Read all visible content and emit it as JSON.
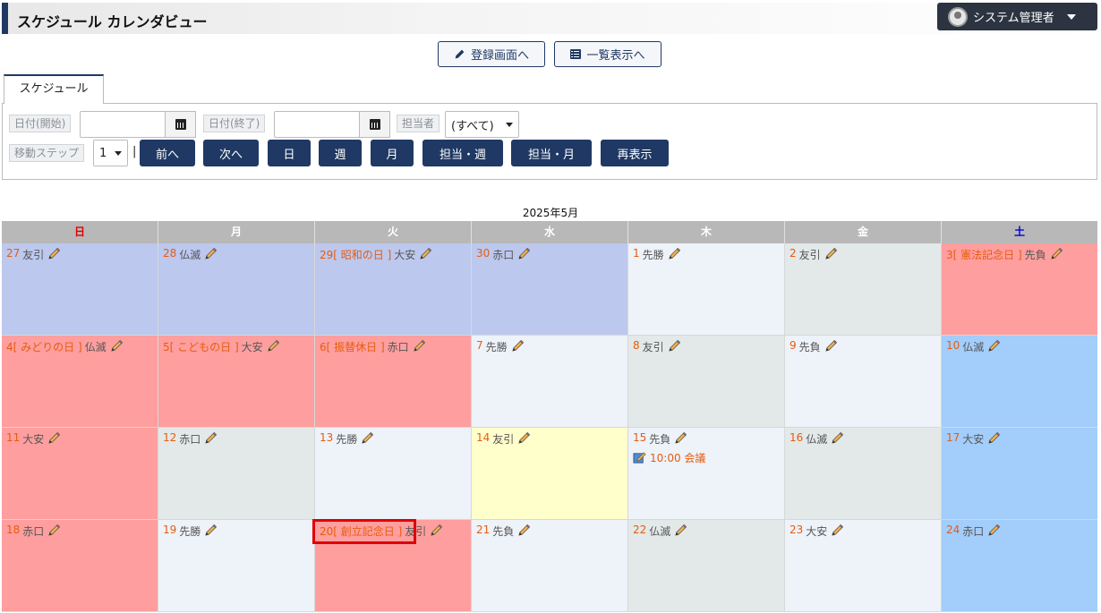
{
  "header": {
    "title": "スケジュール カレンダビュー",
    "user": "システム管理者"
  },
  "top_buttons": {
    "register": "登録画面へ",
    "list": "一覧表示へ"
  },
  "tab": {
    "label": "スケジュール"
  },
  "filters": {
    "date_start_label": "日付(開始)",
    "date_end_label": "日付(終了)",
    "assignee_label": "担当者",
    "assignee_value": "(すべて)",
    "step_label": "移動ステップ",
    "step_value": "1",
    "separator": "|"
  },
  "nav_buttons": [
    "前へ",
    "次へ",
    "日",
    "週",
    "月",
    "担当・週",
    "担当・月",
    "再表示"
  ],
  "calendar": {
    "month": "2025年5月",
    "weekdays": [
      "日",
      "月",
      "火",
      "水",
      "木",
      "金",
      "土"
    ],
    "weeks": [
      [
        {
          "label": "27",
          "rokuyo": "友引",
          "type": "prev"
        },
        {
          "label": "28",
          "rokuyo": "仏滅",
          "type": "prev"
        },
        {
          "label": "29[ 昭和の日 ]",
          "rokuyo": "大安",
          "type": "prev"
        },
        {
          "label": "30",
          "rokuyo": "赤口",
          "type": "prev"
        },
        {
          "label": "1",
          "rokuyo": "先勝",
          "type": "weekday"
        },
        {
          "label": "2",
          "rokuyo": "友引",
          "type": "thu"
        },
        {
          "label": "3[ 憲法記念日 ]",
          "rokuyo": "先負",
          "type": "holiday"
        }
      ],
      [
        {
          "label": "4[ みどりの日 ]",
          "rokuyo": "仏滅",
          "type": "holiday"
        },
        {
          "label": "5[ こどもの日 ]",
          "rokuyo": "大安",
          "type": "holiday"
        },
        {
          "label": "6[ 振替休日 ]",
          "rokuyo": "赤口",
          "type": "holiday"
        },
        {
          "label": "7",
          "rokuyo": "先勝",
          "type": "weekday"
        },
        {
          "label": "8",
          "rokuyo": "友引",
          "type": "thu"
        },
        {
          "label": "9",
          "rokuyo": "先負",
          "type": "weekday"
        },
        {
          "label": "10",
          "rokuyo": "仏滅",
          "type": "sat"
        }
      ],
      [
        {
          "label": "11",
          "rokuyo": "大安",
          "type": "holiday"
        },
        {
          "label": "12",
          "rokuyo": "赤口",
          "type": "thu"
        },
        {
          "label": "13",
          "rokuyo": "先勝",
          "type": "weekday"
        },
        {
          "label": "14",
          "rokuyo": "友引",
          "type": "today"
        },
        {
          "label": "15",
          "rokuyo": "先負",
          "type": "weekday",
          "event": "10:00 会議"
        },
        {
          "label": "16",
          "rokuyo": "仏滅",
          "type": "thu"
        },
        {
          "label": "17",
          "rokuyo": "大安",
          "type": "sat"
        }
      ],
      [
        {
          "label": "18",
          "rokuyo": "赤口",
          "type": "holiday"
        },
        {
          "label": "19",
          "rokuyo": "先勝",
          "type": "weekday"
        },
        {
          "label": "20[ 創立記念日 ]",
          "rokuyo": "友引",
          "type": "holiday"
        },
        {
          "label": "21",
          "rokuyo": "先負",
          "type": "weekday"
        },
        {
          "label": "22",
          "rokuyo": "仏滅",
          "type": "thu"
        },
        {
          "label": "23",
          "rokuyo": "大安",
          "type": "weekday"
        },
        {
          "label": "24",
          "rokuyo": "赤口",
          "type": "sat"
        }
      ]
    ]
  }
}
